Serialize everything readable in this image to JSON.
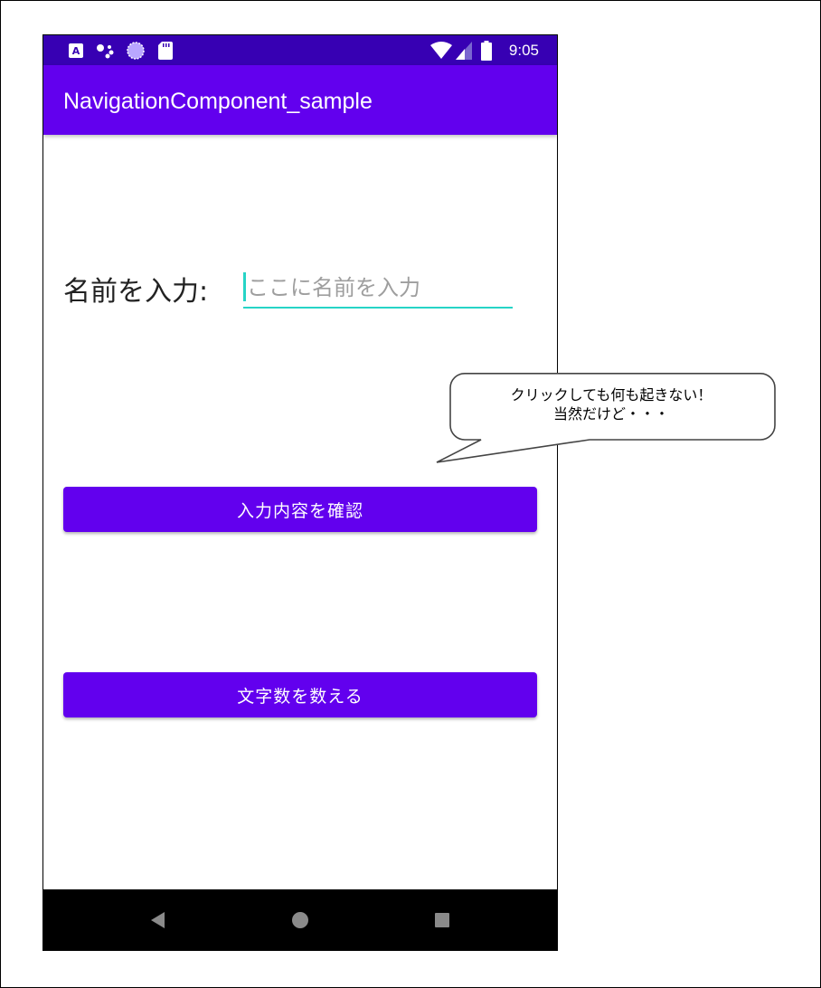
{
  "status_bar": {
    "time": "9:05",
    "icons": [
      "app-a-icon",
      "assistant-dots-icon",
      "loading-circle-icon",
      "sd-card-icon",
      "wifi-icon",
      "signal-icon",
      "battery-icon"
    ]
  },
  "app_bar": {
    "title": "NavigationComponent_sample"
  },
  "form": {
    "name_label": "名前を入力:",
    "name_input_value": "",
    "name_input_placeholder": "ここに名前を入力"
  },
  "buttons": {
    "confirm_label": "入力内容を確認",
    "count_label": "文字数を数える"
  },
  "callout": {
    "line1": "クリックしても何も起きない！",
    "line2": "当然だけど・・・"
  },
  "nav_bar": {
    "icons": [
      "back-icon",
      "home-icon",
      "recents-icon"
    ]
  },
  "colors": {
    "status_bar": "#3700b3",
    "primary": "#6200ee",
    "accent": "#26d4c6"
  }
}
